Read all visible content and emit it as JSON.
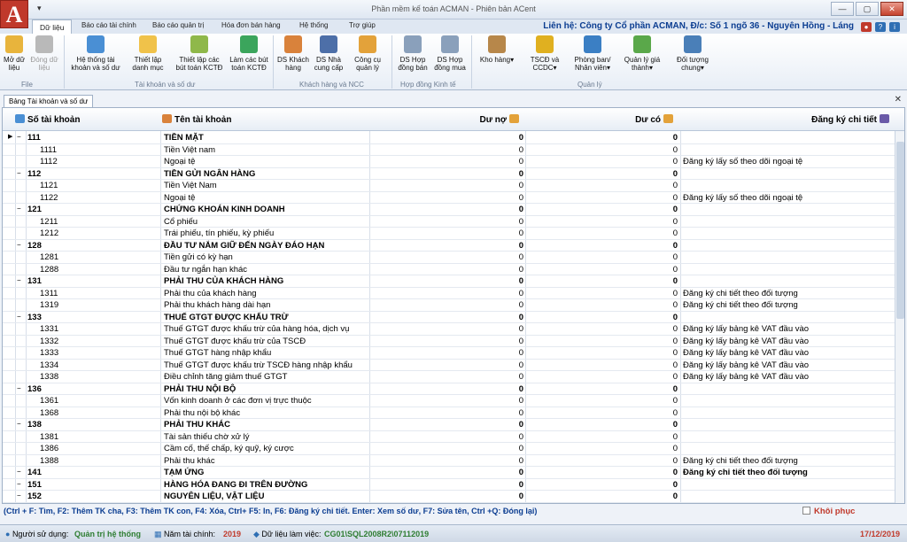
{
  "app": {
    "logo": "A",
    "title": "Phần mềm kế toán ACMAN - Phiên bản ACent",
    "contact": "Liên hệ: Công ty Cổ phần ACMAN, Đ/c: Số 1 ngõ 36 - Nguyên Hồng - Láng"
  },
  "menu_tabs": [
    "Dữ liệu",
    "Báo cáo tài chính",
    "Báo cáo quản trị",
    "Hóa đơn bán hàng",
    "Hệ thống",
    "Trợ giúp"
  ],
  "ribbon": {
    "buttons": [
      "Mở dữ liệu",
      "Đóng dữ liệu",
      "Hệ thống tài khoản và số dư",
      "Thiết lập danh mục",
      "Thiết lập các bút toán KCTĐ",
      "Làm các bút toán KCTĐ",
      "DS Khách hàng",
      "DS Nhà cung cấp",
      "Công cụ quản lý",
      "DS Hợp đồng bán",
      "DS Hợp đồng mua",
      "Kho hàng",
      "TSCĐ và CCDC",
      "Phòng ban/ Nhân viên",
      "Quản lý giá thành",
      "Đối tượng chung"
    ],
    "groups": [
      "File",
      "Tài khoản và số dư",
      "Khách hàng và NCC",
      "Hợp đồng Kinh tế",
      "Quản lý"
    ]
  },
  "doc_tab": "Bảng Tài khoản và số dư",
  "columns": {
    "account": "Số tài khoản",
    "name": "Tên tài khoản",
    "debit": "Dư nợ",
    "credit": "Dư có",
    "detail": "Đăng ký chi tiết"
  },
  "rows": [
    {
      "acc": "111",
      "name": "TIỀN MẶT",
      "debit": "0",
      "credit": "0",
      "detail": "",
      "level": 0
    },
    {
      "acc": "1111",
      "name": "Tiền Việt nam",
      "debit": "0",
      "credit": "0",
      "detail": "",
      "level": 1
    },
    {
      "acc": "1112",
      "name": "Ngoại tệ",
      "debit": "0",
      "credit": "0",
      "detail": "Đăng ký lấy số theo dõi ngoại tệ",
      "level": 1
    },
    {
      "acc": "112",
      "name": "TIỀN GỬI NGÂN HÀNG",
      "debit": "0",
      "credit": "0",
      "detail": "",
      "level": 0
    },
    {
      "acc": "1121",
      "name": "Tiền Việt Nam",
      "debit": "0",
      "credit": "0",
      "detail": "",
      "level": 1
    },
    {
      "acc": "1122",
      "name": "Ngoại tệ",
      "debit": "0",
      "credit": "0",
      "detail": "Đăng ký lấy số theo dõi ngoại tệ",
      "level": 1
    },
    {
      "acc": "121",
      "name": "CHỨNG KHOÁN KINH DOANH",
      "debit": "0",
      "credit": "0",
      "detail": "",
      "level": 0
    },
    {
      "acc": "1211",
      "name": "Cổ phiếu",
      "debit": "0",
      "credit": "0",
      "detail": "",
      "level": 1
    },
    {
      "acc": "1212",
      "name": "Trái phiếu, tín phiếu, kỳ phiếu",
      "debit": "0",
      "credit": "0",
      "detail": "",
      "level": 1
    },
    {
      "acc": "128",
      "name": "ĐẦU TƯ NẮM GIỮ ĐẾN NGÀY ĐÁO HẠN",
      "debit": "0",
      "credit": "0",
      "detail": "",
      "level": 0
    },
    {
      "acc": "1281",
      "name": "Tiền gửi có kỳ hạn",
      "debit": "0",
      "credit": "0",
      "detail": "",
      "level": 1
    },
    {
      "acc": "1288",
      "name": "Đầu tư ngắn hạn khác",
      "debit": "0",
      "credit": "0",
      "detail": "",
      "level": 1
    },
    {
      "acc": "131",
      "name": "PHẢI THU CỦA KHÁCH HÀNG",
      "debit": "0",
      "credit": "0",
      "detail": "",
      "level": 0
    },
    {
      "acc": "1311",
      "name": "Phải thu của khách hàng",
      "debit": "0",
      "credit": "0",
      "detail": "Đăng ký chi tiết theo đối tượng",
      "level": 1
    },
    {
      "acc": "1319",
      "name": "Phải thu khách hàng dài hạn",
      "debit": "0",
      "credit": "0",
      "detail": "Đăng ký chi tiết theo đối tượng",
      "level": 1
    },
    {
      "acc": "133",
      "name": "THUẾ GTGT ĐƯỢC KHẤU TRỪ",
      "debit": "0",
      "credit": "0",
      "detail": "",
      "level": 0
    },
    {
      "acc": "1331",
      "name": "Thuế GTGT được khấu trừ của hàng hóa, dịch vụ",
      "debit": "0",
      "credit": "0",
      "detail": "Đăng ký lấy bảng kê VAT đầu vào",
      "level": 1
    },
    {
      "acc": "1332",
      "name": "Thuế GTGT được khấu trừ của TSCĐ",
      "debit": "0",
      "credit": "0",
      "detail": "Đăng ký lấy bảng kê VAT đầu vào",
      "level": 1
    },
    {
      "acc": "1333",
      "name": "Thuế GTGT hàng nhập khẩu",
      "debit": "0",
      "credit": "0",
      "detail": "Đăng ký lấy bảng kê VAT đầu vào",
      "level": 1
    },
    {
      "acc": "1334",
      "name": "Thuế GTGT được khấu trừ TSCĐ hàng nhập khẩu",
      "debit": "0",
      "credit": "0",
      "detail": "Đăng ký lấy bảng kê VAT đầu vào",
      "level": 1
    },
    {
      "acc": "1338",
      "name": "Điều chỉnh tăng giảm thuế GTGT",
      "debit": "0",
      "credit": "0",
      "detail": "Đăng ký lấy bảng kê VAT đầu vào",
      "level": 1
    },
    {
      "acc": "136",
      "name": "PHẢI THU NỘI BỘ",
      "debit": "0",
      "credit": "0",
      "detail": "",
      "level": 0
    },
    {
      "acc": "1361",
      "name": "Vốn kinh doanh ở các đơn vị trực thuộc",
      "debit": "0",
      "credit": "0",
      "detail": "",
      "level": 1
    },
    {
      "acc": "1368",
      "name": "Phải thu nội bộ khác",
      "debit": "0",
      "credit": "0",
      "detail": "",
      "level": 1
    },
    {
      "acc": "138",
      "name": "PHẢI THU KHÁC",
      "debit": "0",
      "credit": "0",
      "detail": "",
      "level": 0
    },
    {
      "acc": "1381",
      "name": "Tài sản thiếu chờ xử lý",
      "debit": "0",
      "credit": "0",
      "detail": "",
      "level": 1
    },
    {
      "acc": "1386",
      "name": "Cầm cố, thế chấp, ký quỹ, ký cược",
      "debit": "0",
      "credit": "0",
      "detail": "",
      "level": 1
    },
    {
      "acc": "1388",
      "name": "Phải thu khác",
      "debit": "0",
      "credit": "0",
      "detail": "Đăng ký chi tiết theo đối tượng",
      "level": 1
    },
    {
      "acc": "141",
      "name": "TẠM ỨNG",
      "debit": "0",
      "credit": "0",
      "detail": "Đăng ký chi tiết theo đối tượng",
      "level": 0
    },
    {
      "acc": "151",
      "name": "HÀNG HÓA ĐANG ĐI TRÊN ĐƯỜNG",
      "debit": "0",
      "credit": "0",
      "detail": "",
      "level": 0
    },
    {
      "acc": "152",
      "name": "NGUYÊN LIỆU, VẬT LIỆU",
      "debit": "0",
      "credit": "0",
      "detail": "",
      "level": 0
    }
  ],
  "hint": "(Ctrl + F: Tìm, F2: Thêm TK cha, F3: Thêm TK con, F4: Xóa, Ctrl+ F5: In, F6: Đăng ký chi tiết. Enter: Xem số dư, F7: Sửa tên, Ctrl +Q: Đóng lại)",
  "restore_label": "Khôi phục",
  "status": {
    "user_label": "Người sử dụng:",
    "user": "Quản trị hệ thống",
    "year_label": "Năm tài chính:",
    "year": "2019",
    "data_label": "Dữ liệu làm việc:",
    "data": "CG01\\SQL2008R2\\07112019",
    "date": "17/12/2019"
  },
  "colors": {
    "accent": "#0b3d91",
    "logo": "#c0392b",
    "status_green": "#2e7d32",
    "status_red": "#c0392b"
  }
}
